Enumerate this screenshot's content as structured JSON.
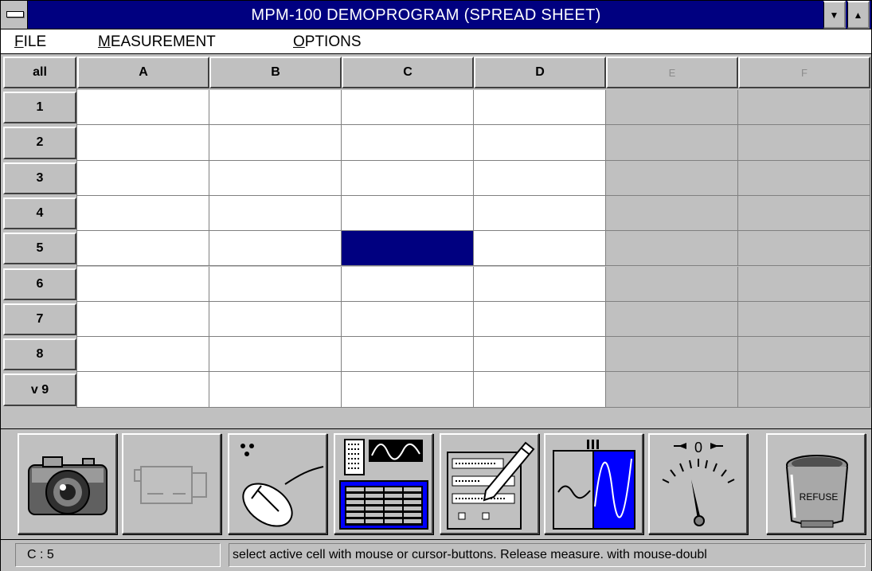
{
  "window": {
    "title": "MPM-100  DEMOPROGRAM (SPREAD SHEET)"
  },
  "title_buttons": {
    "minimize": "▼",
    "maximize": "▲"
  },
  "menu": [
    {
      "accel": "F",
      "rest": "ILE"
    },
    {
      "accel": "M",
      "rest": "EASUREMENT"
    },
    {
      "accel": "O",
      "rest": "PTIONS"
    }
  ],
  "grid": {
    "corner_label": "all",
    "columns": [
      "A",
      "B",
      "C",
      "D",
      "E",
      "F"
    ],
    "disabled_columns": [
      "E",
      "F"
    ],
    "rows": [
      "1",
      "2",
      "3",
      "4",
      "5",
      "6",
      "7",
      "8",
      "v 9"
    ],
    "selected_cell": {
      "column": "C",
      "row": "5"
    }
  },
  "toolbar": {
    "tools": [
      {
        "name": "camera",
        "icon": "camera-icon",
        "enabled": true
      },
      {
        "name": "video-camera",
        "icon": "video-camera-icon",
        "enabled": false
      },
      {
        "name": "mouse",
        "icon": "mouse-icon",
        "enabled": true
      },
      {
        "name": "spreadsheet-view",
        "icon": "spreadsheet-view-icon",
        "enabled": true,
        "active": true
      },
      {
        "name": "form-edit",
        "icon": "form-edit-icon",
        "enabled": true
      },
      {
        "name": "waveform-zoom",
        "icon": "waveform-zoom-icon",
        "enabled": true
      },
      {
        "name": "meter",
        "icon": "meter-icon",
        "enabled": true
      },
      {
        "name": "refuse",
        "icon": "refuse-bin-icon",
        "enabled": true
      }
    ],
    "refuse_text": "REFUSE",
    "meter_zero": "0"
  },
  "status": {
    "cell": "C : 5",
    "message": "select active cell with mouse or cursor-buttons. Release measure. with mouse-doubl"
  },
  "colors": {
    "title_bar": "#000080",
    "selection": "#000080",
    "face": "#c0c0c0"
  }
}
